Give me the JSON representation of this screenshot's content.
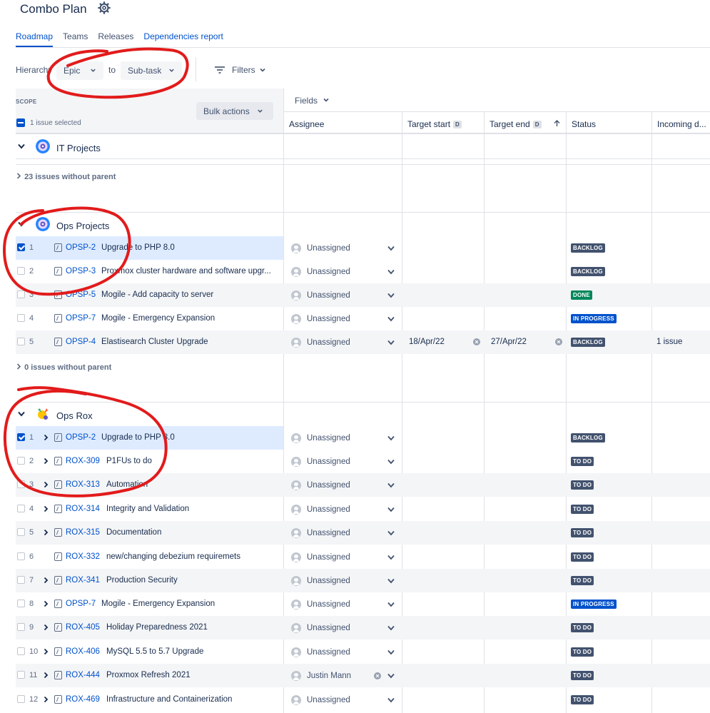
{
  "page": {
    "title": "Combo Plan",
    "icons": {
      "gear": "gear-icon",
      "filters": "filter-lines-icon"
    }
  },
  "tabs": [
    "Roadmap",
    "Teams",
    "Releases",
    "Dependencies report"
  ],
  "hierarchy": {
    "label": "Hierarchy",
    "from": "Epic",
    "to_label": "to",
    "to": "Sub-task"
  },
  "filters_label": "Filters",
  "scope": {
    "header": "SCOPE",
    "selected_text": "1 issue selected",
    "bulk_actions": "Bulk actions"
  },
  "fields_label": "Fields",
  "columns": [
    "Assignee",
    "Target start",
    "Target end",
    "Status",
    "Incoming d..."
  ],
  "column_badge": "D",
  "groups": [
    {
      "name": "IT Projects",
      "no_parent": "23 issues without parent"
    },
    {
      "name": "Ops Projects",
      "no_parent": "0 issues without parent"
    },
    {
      "name": "Ops Rox"
    }
  ],
  "ops_projects_rows": [
    {
      "num": "1",
      "key": "OPSP-2",
      "summary": "Upgrade to PHP 8.0",
      "assignee": "Unassigned",
      "status": "BACKLOG",
      "selected": true
    },
    {
      "num": "2",
      "key": "OPSP-3",
      "summary": "Proxmox cluster hardware and software upgr...",
      "assignee": "Unassigned",
      "status": "BACKLOG"
    },
    {
      "num": "3",
      "key": "OPSP-5",
      "summary": "Mogile - Add capacity to server",
      "assignee": "Unassigned",
      "status": "DONE"
    },
    {
      "num": "4",
      "key": "OPSP-7",
      "summary": "Mogile - Emergency Expansion",
      "assignee": "Unassigned",
      "status": "IN PROGRESS"
    },
    {
      "num": "5",
      "key": "OPSP-4",
      "summary": "Elastisearch Cluster Upgrade",
      "assignee": "Unassigned",
      "start": "18/Apr/22",
      "end": "27/Apr/22",
      "status": "BACKLOG",
      "incoming": "1 issue"
    }
  ],
  "ops_rox_rows": [
    {
      "num": "1",
      "key": "OPSP-2",
      "summary": "Upgrade to PHP 8.0",
      "assignee": "Unassigned",
      "status": "BACKLOG",
      "selected": true
    },
    {
      "num": "2",
      "key": "ROX-309",
      "summary": "P1FUs to do",
      "assignee": "Unassigned",
      "status": "TO DO"
    },
    {
      "num": "3",
      "key": "ROX-313",
      "summary": "Automation",
      "assignee": "Unassigned",
      "status": "TO DO"
    },
    {
      "num": "4",
      "key": "ROX-314",
      "summary": "Integrity and Validation",
      "assignee": "Unassigned",
      "status": "TO DO"
    },
    {
      "num": "5",
      "key": "ROX-315",
      "summary": "Documentation",
      "assignee": "Unassigned",
      "status": "TO DO"
    },
    {
      "num": "6",
      "key": "ROX-332",
      "summary": "new/changing debezium requiremets",
      "assignee": "Unassigned",
      "status": "TO DO"
    },
    {
      "num": "7",
      "key": "ROX-341",
      "summary": "Production Security",
      "assignee": "Unassigned",
      "status": "TO DO"
    },
    {
      "num": "8",
      "key": "OPSP-7",
      "summary": "Mogile - Emergency Expansion",
      "assignee": "Unassigned",
      "status": "IN PROGRESS"
    },
    {
      "num": "9",
      "key": "ROX-405",
      "summary": "Holiday Preparedness 2021",
      "assignee": "Unassigned",
      "status": "TO DO"
    },
    {
      "num": "10",
      "key": "ROX-406",
      "summary": "MySQL 5.5 to 5.7 Upgrade",
      "assignee": "Unassigned",
      "status": "TO DO"
    },
    {
      "num": "11",
      "key": "ROX-444",
      "summary": "Proxmox Refresh 2021",
      "assignee": "Justin Mann",
      "status": "TO DO"
    },
    {
      "num": "12",
      "key": "ROX-469",
      "summary": "Infrastructure and Containerization",
      "assignee": "Unassigned",
      "status": "TO DO"
    }
  ],
  "colors": {
    "accent": "#0052cc",
    "backlog": "#42526e",
    "done": "#00875a",
    "in_progress": "#0052cc"
  }
}
